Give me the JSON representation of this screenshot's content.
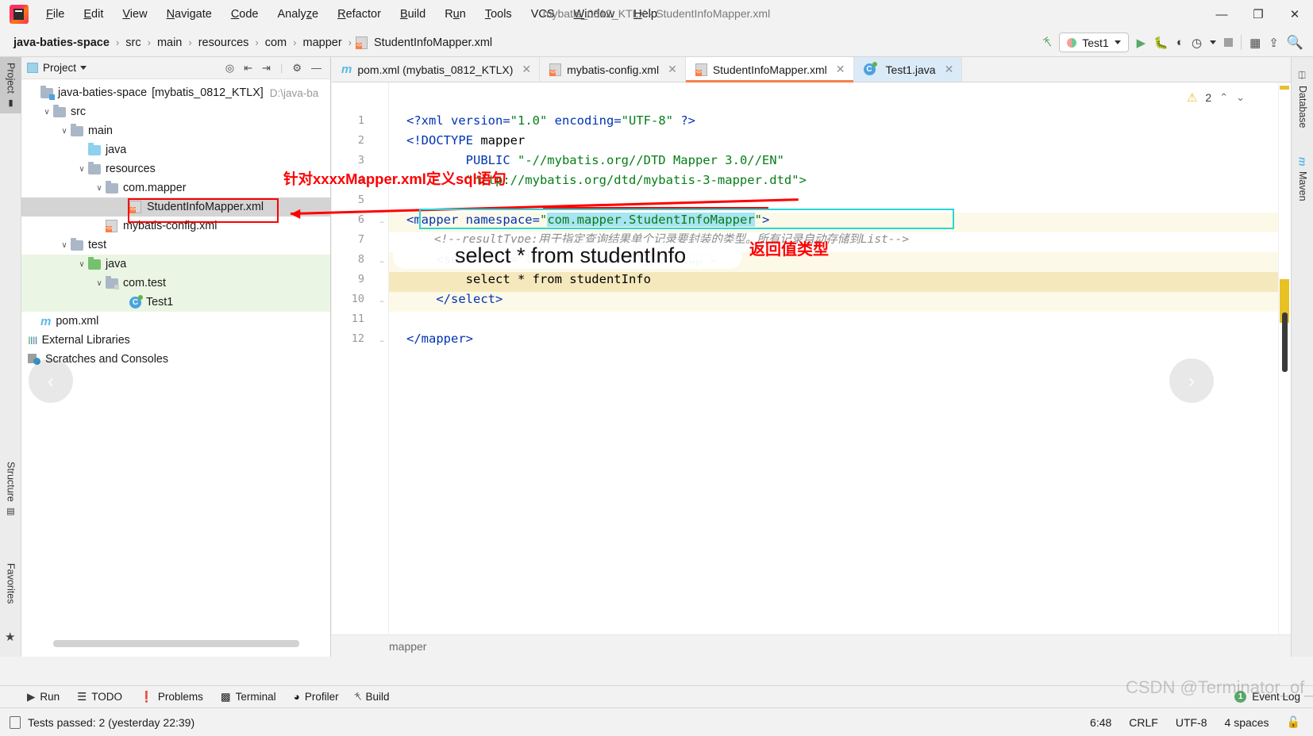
{
  "window": {
    "title": "mybatis_0812_KTLX - StudentInfoMapper.xml",
    "minimize": "—",
    "maximize": "❐",
    "close": "✕"
  },
  "menubar": [
    {
      "label": "File",
      "mnemonic": "F"
    },
    {
      "label": "Edit",
      "mnemonic": "E"
    },
    {
      "label": "View",
      "mnemonic": "V"
    },
    {
      "label": "Navigate",
      "mnemonic": "N"
    },
    {
      "label": "Code",
      "mnemonic": "C"
    },
    {
      "label": "Analyze",
      "mnemonic": "z"
    },
    {
      "label": "Refactor",
      "mnemonic": "R"
    },
    {
      "label": "Build",
      "mnemonic": "B"
    },
    {
      "label": "Run",
      "mnemonic": "u"
    },
    {
      "label": "Tools",
      "mnemonic": "T"
    },
    {
      "label": "VCS",
      "mnemonic": ""
    },
    {
      "label": "Window",
      "mnemonic": "W"
    },
    {
      "label": "Help",
      "mnemonic": "H"
    }
  ],
  "breadcrumb": {
    "items": [
      "java-baties-space",
      "src",
      "main",
      "resources",
      "com",
      "mapper",
      "StudentInfoMapper.xml"
    ],
    "separator": "›"
  },
  "toolbar_right": {
    "build_icon": "hammer-icon",
    "run_config": "Test1",
    "run_icon": "run-icon",
    "debug_icon": "debug-icon",
    "coverage_icon": "coverage-icon",
    "profile_icon": "profile-icon",
    "stop_icon": "stop-icon",
    "layout_icon": "layout-icon",
    "updates_icon": "updates-icon",
    "search_icon": "search-icon"
  },
  "left_strip": [
    {
      "label": "Project",
      "active": true
    },
    {
      "label": "Structure",
      "active": false
    },
    {
      "label": "Favorites",
      "active": false
    }
  ],
  "right_strip": [
    {
      "label": "Database"
    },
    {
      "label": "Maven"
    }
  ],
  "project_panel": {
    "title": "Project",
    "tools": [
      "locate-icon",
      "expand-all-icon",
      "collapse-all-icon",
      "settings-icon",
      "hide-icon"
    ],
    "tree": [
      {
        "indent": 0,
        "chev": "",
        "icon": "module-folder",
        "label": "java-baties-space",
        "bold_label": "[mybatis_0812_KTLX]",
        "path": "D:\\java-ba",
        "selected": false,
        "green": false
      },
      {
        "indent": 1,
        "chev": "∨",
        "icon": "folder",
        "label": "src",
        "selected": false,
        "green": false
      },
      {
        "indent": 2,
        "chev": "∨",
        "icon": "folder",
        "label": "main",
        "selected": false,
        "green": false
      },
      {
        "indent": 3,
        "chev": "",
        "icon": "folder-blue",
        "label": "java",
        "selected": false,
        "green": false
      },
      {
        "indent": 3,
        "chev": "∨",
        "icon": "folder-resources",
        "label": "resources",
        "selected": false,
        "green": false
      },
      {
        "indent": 4,
        "chev": "∨",
        "icon": "folder",
        "label": "com.mapper",
        "selected": false,
        "green": false
      },
      {
        "indent": 5,
        "chev": "",
        "icon": "xml-file",
        "label": "StudentInfoMapper.xml",
        "selected": true,
        "green": false
      },
      {
        "indent": 4,
        "chev": "",
        "icon": "xml-file",
        "label": "mybatis-config.xml",
        "selected": false,
        "green": false
      },
      {
        "indent": 2,
        "chev": "∨",
        "icon": "folder",
        "label": "test",
        "selected": false,
        "green": false
      },
      {
        "indent": 3,
        "chev": "∨",
        "icon": "folder-green",
        "label": "java",
        "selected": false,
        "green": true
      },
      {
        "indent": 4,
        "chev": "∨",
        "icon": "folder-pkg",
        "label": "com.test",
        "selected": false,
        "green": true
      },
      {
        "indent": 5,
        "chev": "",
        "icon": "java-class",
        "label": "Test1",
        "selected": false,
        "green": true
      },
      {
        "indent": 1,
        "chev": "",
        "icon": "maven-file",
        "label": "pom.xml",
        "selected": false,
        "green": false
      },
      {
        "indent": 0,
        "chev": "",
        "icon": "libraries",
        "label": "External Libraries",
        "selected": false,
        "green": false
      },
      {
        "indent": 0,
        "chev": "",
        "icon": "scratches",
        "label": "Scratches and Consoles",
        "selected": false,
        "green": false
      }
    ]
  },
  "editor_tabs": [
    {
      "label": "pom.xml (mybatis_0812_KTLX)",
      "icon": "maven-file-icon",
      "state": "inactive",
      "close": "✕"
    },
    {
      "label": "mybatis-config.xml",
      "icon": "xml-file-icon",
      "state": "inactive",
      "close": "✕"
    },
    {
      "label": "StudentInfoMapper.xml",
      "icon": "xml-file-icon",
      "state": "current",
      "close": "✕"
    },
    {
      "label": "Test1.java",
      "icon": "java-class-icon",
      "state": "active",
      "close": "✕"
    }
  ],
  "editor": {
    "warning_count": "2",
    "warning_icon": "warning-triangle-icon",
    "up_icon": "⌃",
    "down_icon": "⌄",
    "prev_nav_icon": "‹",
    "next_nav_icon": "›",
    "breadcrumb_bottom": "mapper",
    "lines": [
      {
        "n": "1",
        "fold": "",
        "hl": "",
        "segs": [
          {
            "t": "<?xml ",
            "c": "tok-tag"
          },
          {
            "t": "version=",
            "c": "tok-attr"
          },
          {
            "t": "\"1.0\"",
            "c": "tok-str"
          },
          {
            "t": " encoding=",
            "c": "tok-attr"
          },
          {
            "t": "\"UTF-8\"",
            "c": "tok-str"
          },
          {
            "t": " ?>",
            "c": "tok-tag"
          }
        ]
      },
      {
        "n": "2",
        "fold": "",
        "hl": "",
        "segs": [
          {
            "t": "<!DOCTYPE ",
            "c": "tok-tag"
          },
          {
            "t": "mapper",
            "c": "tok-dflt"
          }
        ]
      },
      {
        "n": "3",
        "fold": "",
        "hl": "",
        "segs": [
          {
            "t": "        PUBLIC ",
            "c": "tok-tag"
          },
          {
            "t": "\"-//mybatis.org//DTD Mapper 3.0//EN\"",
            "c": "tok-str"
          }
        ]
      },
      {
        "n": "4",
        "fold": "",
        "hl": "",
        "segs": [
          {
            "t": "        ",
            "c": "tok-dflt"
          },
          {
            "t": "\"http://mybatis.org/dtd/mybatis-3-mapper.dtd\">",
            "c": "tok-str"
          }
        ]
      },
      {
        "n": "5",
        "fold": "",
        "hl": "",
        "segs": []
      },
      {
        "n": "6",
        "fold": "−",
        "hl": "hl-light",
        "segs": [
          {
            "t": "<mapper ",
            "c": "tok-tag"
          },
          {
            "t": "namespace=",
            "c": "tok-attr"
          },
          {
            "t": "\"",
            "c": "tok-str"
          },
          {
            "t": "com.mapper.StudentInfoMapper",
            "c": "tok-str sel-hl"
          },
          {
            "t": "\"",
            "c": "tok-str"
          },
          {
            "t": ">",
            "c": "tok-tag"
          }
        ]
      },
      {
        "n": "7",
        "fold": "",
        "hl": "",
        "segs": [
          {
            "t": "    <!--resultType:用于指定查询结果单个记录要封装的类型。所有记录自动存储到List-->",
            "c": "tok-cmt"
          }
        ]
      },
      {
        "n": "8",
        "fold": "−",
        "hl": "hl-light",
        "segs": [
          {
            "t": "    <select ",
            "c": "tok-tag"
          },
          {
            "t": "id=",
            "c": "tok-attr"
          },
          {
            "t": "\"listAll\"",
            "c": "tok-str"
          },
          {
            "t": " resultType=",
            "c": "tok-attr"
          },
          {
            "t": "\"map\"",
            "c": "tok-str"
          },
          {
            "t": ">",
            "c": "tok-tag"
          }
        ]
      },
      {
        "n": "9",
        "fold": "",
        "hl": "hl-strong",
        "segs": [
          {
            "t": "        select * from studentInfo",
            "c": "tok-dflt"
          }
        ]
      },
      {
        "n": "10",
        "fold": "−",
        "hl": "hl-light",
        "segs": [
          {
            "t": "    </select>",
            "c": "tok-tag"
          }
        ]
      },
      {
        "n": "11",
        "fold": "",
        "hl": "",
        "segs": []
      },
      {
        "n": "12",
        "fold": "−",
        "hl": "",
        "segs": [
          {
            "t": "</mapper>",
            "c": "tok-tag"
          }
        ]
      }
    ]
  },
  "annotations": {
    "mapper_def": "针对xxxxMapper.xml定义sql语句",
    "return_type": "返回值类型",
    "sql_handwritten": "select * from studentInfo"
  },
  "bottom_bar": {
    "items": [
      {
        "label": "Run",
        "icon": "run-icon"
      },
      {
        "label": "TODO",
        "icon": "todo-icon"
      },
      {
        "label": "Problems",
        "icon": "problems-icon"
      },
      {
        "label": "Terminal",
        "icon": "terminal-icon"
      },
      {
        "label": "Profiler",
        "icon": "profiler-icon"
      },
      {
        "label": "Build",
        "icon": "build-icon"
      }
    ],
    "event_log": "Event Log",
    "event_log_count": "1"
  },
  "statusbar": {
    "message": "Tests passed: 2 (yesterday 22:39)",
    "caret": "6:48",
    "line_sep": "CRLF",
    "encoding": "UTF-8",
    "indent": "4 spaces",
    "lock_icon": "lock-icon"
  },
  "watermark": "CSDN @Terminator_of_Bug"
}
